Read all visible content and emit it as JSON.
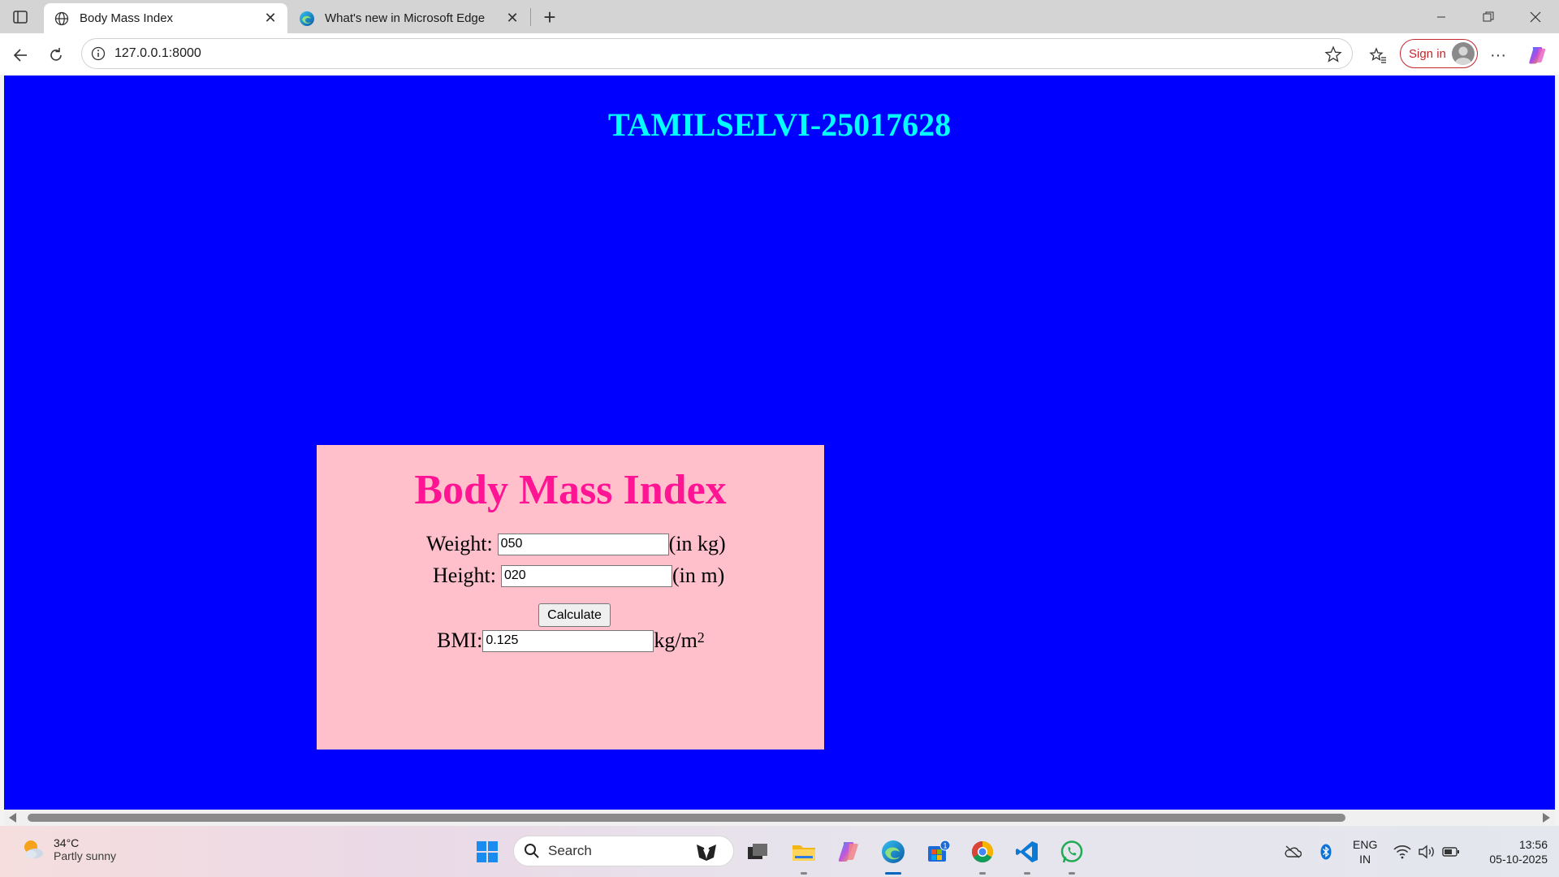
{
  "browser": {
    "tabs": [
      {
        "title": "Body Mass Index",
        "active": true
      },
      {
        "title": "What's new in Microsoft Edge",
        "active": false
      }
    ],
    "address": {
      "url": "127.0.0.1:8000"
    },
    "signin_label": "Sign in",
    "more_label": "···"
  },
  "page": {
    "heading": "TAMILSELVI-25017628",
    "colors": {
      "background": "#0000ff",
      "heading": "#00ffff",
      "card": "#ffc0cb",
      "card_title": "#ff1493"
    }
  },
  "bmi_form": {
    "title": "Body Mass Index",
    "weight": {
      "label": "Weight:",
      "value": "050",
      "unit": "(in kg)"
    },
    "height": {
      "label": "Height:",
      "value": "020",
      "unit": "(in m)"
    },
    "calculate_label": "Calculate",
    "result": {
      "label": "BMI:",
      "value": "0.125",
      "unit": "kg/m",
      "unit_exponent": "2"
    }
  },
  "taskbar": {
    "weather": {
      "temperature": "34°C",
      "condition": "Partly sunny"
    },
    "search_label": "Search",
    "store_badge": "1",
    "language": {
      "line1": "ENG",
      "line2": "IN"
    },
    "clock": {
      "time": "13:56",
      "date": "05-10-2025"
    }
  }
}
